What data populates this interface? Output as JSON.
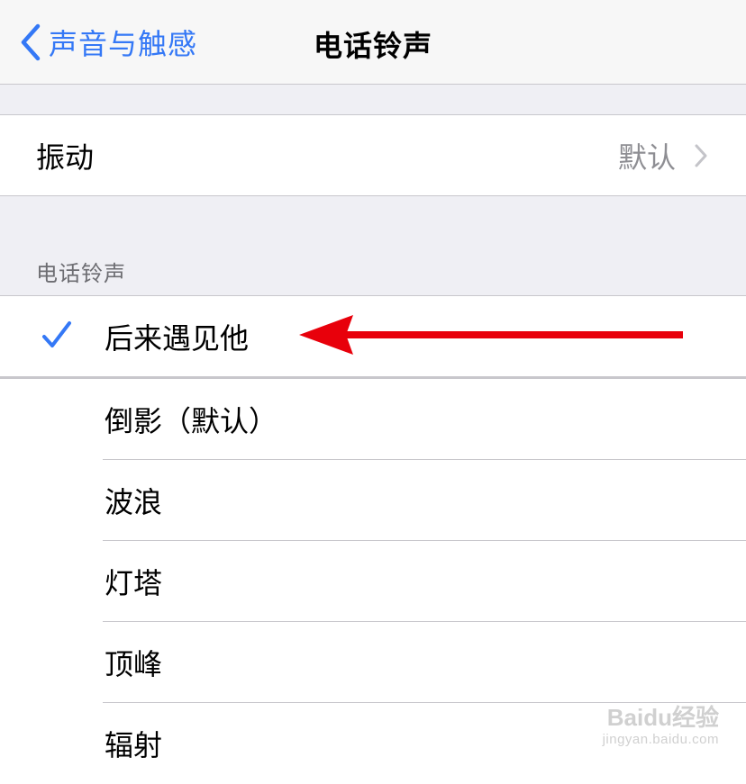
{
  "navbar": {
    "back_label": "声音与触感",
    "title": "电话铃声"
  },
  "vibration": {
    "label": "振动",
    "value": "默认"
  },
  "ringtones": {
    "section_header": "电话铃声",
    "items": [
      {
        "label": "后来遇见他",
        "selected": true
      },
      {
        "label": "倒影（默认）",
        "selected": false
      },
      {
        "label": "波浪",
        "selected": false
      },
      {
        "label": "灯塔",
        "selected": false
      },
      {
        "label": "顶峰",
        "selected": false
      },
      {
        "label": "辐射",
        "selected": false
      }
    ]
  },
  "watermark": {
    "brand": "Baidu经验",
    "url": "jingyan.baidu.com"
  },
  "colors": {
    "accent": "#3478f6",
    "annotation_arrow": "#e8000b",
    "background": "#efeff4"
  },
  "icons": {
    "back": "chevron-left-icon",
    "disclosure": "chevron-right-icon",
    "selected": "checkmark-icon",
    "annotation": "red-arrow-icon"
  }
}
